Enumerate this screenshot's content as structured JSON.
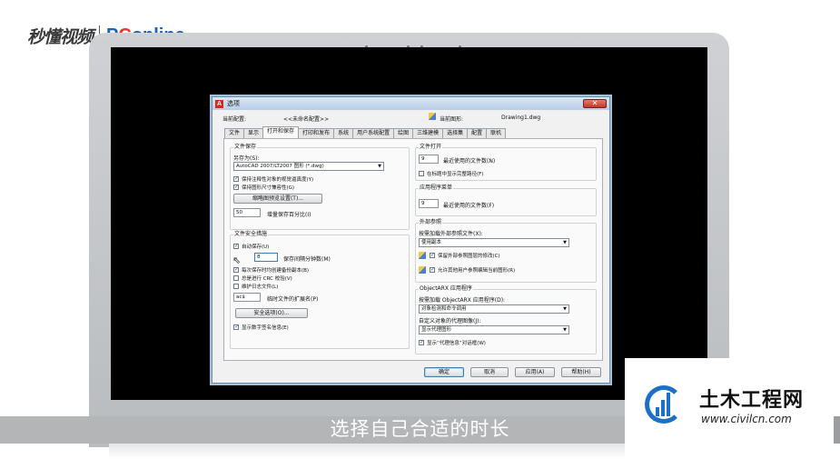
{
  "logos": {
    "left_script": "秒懂视频",
    "left_pc_pre": "P",
    "left_pc_o": "C",
    "left_pc_post": "online"
  },
  "dialog": {
    "title": "选项",
    "close": "✕",
    "current_profile_label": "当前配置:",
    "current_profile_value": "<<未命名配置>>",
    "current_drawing_label": "当前图形:",
    "current_drawing_value": "Drawing1.dwg",
    "tabs": [
      "文件",
      "显示",
      "打开和保存",
      "打印和发布",
      "系统",
      "用户系统配置",
      "绘图",
      "三维建模",
      "选择集",
      "配置",
      "联机"
    ],
    "active_tab_index": 2,
    "file_save": {
      "title": "文件保存",
      "save_as_label": "另存为(S):",
      "save_as_value": "AutoCAD 2007/LT2007 图形 (*.dwg)",
      "cb_annotative": "保持注释性对象的视觉逼真度(Y)",
      "cb_drawing_size": "保持图形尺寸兼容性(G)",
      "thumbnail_button": "缩略图预览设置(T)...",
      "incremental_value": "50",
      "incremental_label": "增量保存百分比(I)"
    },
    "file_safety": {
      "title": "文件安全措施",
      "cb_autosave": "自动保存(U)",
      "minutes_value": "8",
      "minutes_label": "保存间隔分钟数(M)",
      "cb_backup": "每次保存时均创建备份副本(B)",
      "cb_crc": "总是进行 CRC 校验(V)",
      "cb_log": "维护日志文件(L)",
      "ext_value": "ac$",
      "ext_label": "临时文件的扩展名(P)",
      "security_button": "安全选项(O)...",
      "cb_digital_sig": "显示数字签名信息(E)"
    },
    "file_open": {
      "title": "文件打开",
      "recent_value": "9",
      "recent_label": "最近使用的文件数(N)",
      "cb_full_path": "在标题中显示完整路径(F)"
    },
    "app_menu": {
      "title": "应用程序菜单",
      "recent_value": "9",
      "recent_label": "最近使用的文件数(F)"
    },
    "xref": {
      "title": "外部参照",
      "demand_load_label": "按需加载外部参照文件(X):",
      "demand_load_value": "使用副本",
      "cb_retain": "保留外部参照图层的修改(C)",
      "cb_allow_edit": "允许其他用户参照编辑当前图形(R)"
    },
    "objectarx": {
      "title": "ObjectARX 应用程序",
      "load_label": "按需加载 ObjectARX 应用程序(D):",
      "load_value": "对象检测和命令调用",
      "proxy_label": "自定义对象的代理图像(J):",
      "proxy_value": "显示代理图形",
      "cb_proxy_info": "显示“代理信息”对话框(W)"
    },
    "buttons": {
      "ok": "确定",
      "cancel": "取消",
      "apply": "应用(A)",
      "help": "帮助(H)"
    }
  },
  "caption": "选择自己合适的时长",
  "watermark": {
    "title": "土木工程网",
    "url": "www.civilcn.com"
  },
  "colors": {
    "accent": "#1c70c7",
    "close": "#c3392a"
  }
}
